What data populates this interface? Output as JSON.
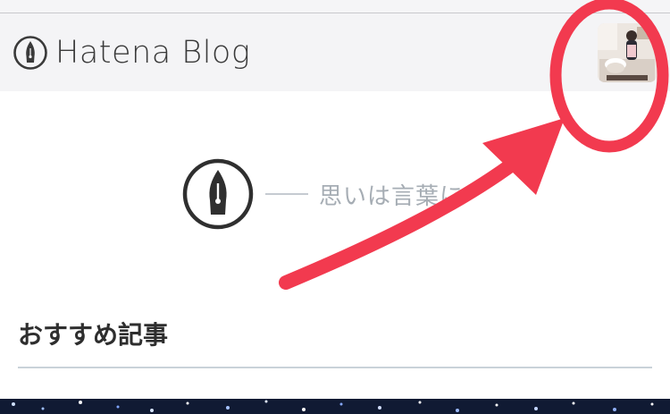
{
  "header": {
    "logo_text": "Hatena Blog",
    "logo_icon": "pen-nib-icon",
    "avatar_icon": "user-avatar"
  },
  "tagline": {
    "icon": "pen-nib-icon",
    "text": "思いは言葉に"
  },
  "recommended": {
    "heading": "おすすめ記事"
  },
  "colors": {
    "header_bg": "#f4f4f6",
    "logo_text": "#3a3a3a",
    "tagline_text": "#a6adb4",
    "heading_text": "#2e2e2e",
    "divider": "#c9d2d9",
    "annotation_red": "#f23a4f"
  },
  "annotation": {
    "circle_target": "avatar-button",
    "arrow_icon": "red-arrow-annotation"
  }
}
